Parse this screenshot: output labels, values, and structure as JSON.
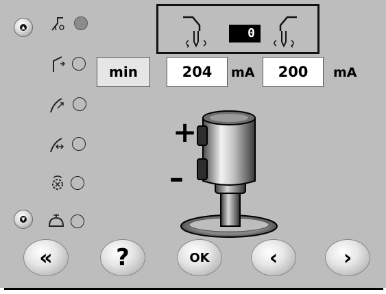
{
  "panel": {
    "counter_value": "0"
  },
  "values": {
    "min_label": "min",
    "current_value": "204",
    "current_unit": "mA",
    "limit_value": "200",
    "limit_unit": "mA"
  },
  "joystick": {
    "plus_label": "+",
    "minus_label": "–"
  },
  "modes": [
    {
      "icon": "torch-swing-icon",
      "selected": true
    },
    {
      "icon": "torch-lift-icon",
      "selected": false
    },
    {
      "icon": "torch-tilt-icon",
      "selected": false
    },
    {
      "icon": "torch-rotate-icon",
      "selected": false
    },
    {
      "icon": "gear-cycle-icon",
      "selected": false
    },
    {
      "icon": "clamp-icon",
      "selected": false
    }
  ],
  "buttons": {
    "back_label": "«",
    "help_label": "?",
    "ok_label": "OK",
    "prev_label": "‹",
    "next_label": "›"
  },
  "colors": {
    "background": "#bdbdbd",
    "display_bg": "#000000",
    "display_fg": "#ffffff",
    "value_bg": "#ffffff"
  }
}
